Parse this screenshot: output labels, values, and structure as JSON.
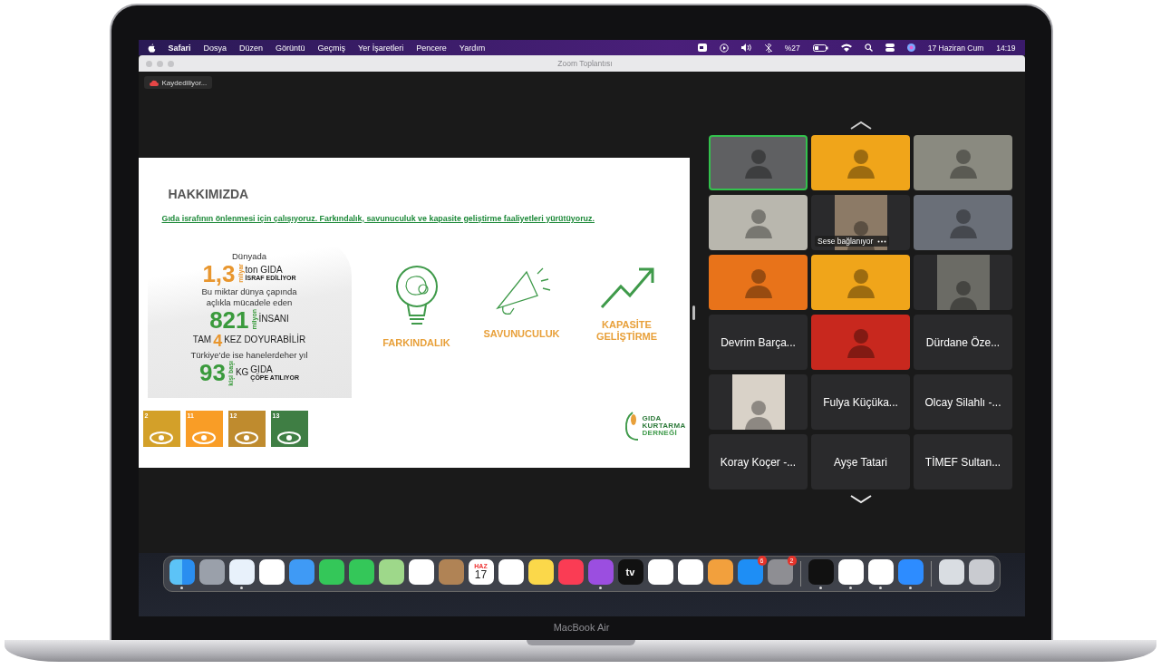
{
  "menubar": {
    "app": "Safari",
    "menus": [
      "Dosya",
      "Düzen",
      "Görüntü",
      "Geçmiş",
      "Yer İşaretleri",
      "Pencere",
      "Yardım"
    ],
    "battery": "%27",
    "date": "17 Haziran Cum",
    "time": "14:19"
  },
  "window": {
    "title": "Zoom Toplantısı",
    "recording": "Kaydediliyor..."
  },
  "slide": {
    "title": "HAKKIMIZDA",
    "subtitle": "Gıda israfının önlenmesi için çalışıyoruz. Farkındalık, savunuculuk ve kapasite geliştirme faaliyetleri yürütüyoruz.",
    "stats": [
      {
        "kind": "line",
        "text": "Dünyada"
      },
      {
        "kind": "figure",
        "number": "1,3",
        "unit": "milyar",
        "text": "ton GIDA",
        "note": "İSRAF EDİLİYOR",
        "color": "#e8962e"
      },
      {
        "kind": "line",
        "text": "Bu miktar dünya çapında"
      },
      {
        "kind": "line",
        "text": "açlıkla mücadele eden"
      },
      {
        "kind": "figure",
        "number": "821",
        "unit": "milyon",
        "text": "İNSANI",
        "color": "#3a9a3c"
      },
      {
        "kind": "times",
        "before": "TAM",
        "number": "4",
        "after": "KEZ DOYURABİLİR"
      },
      {
        "kind": "line",
        "text": "Türkiye'de ise hanelerdeher yıl"
      },
      {
        "kind": "figure",
        "number": "93",
        "unit": "kişi başı",
        "suffix": "KG",
        "text": "GIDA",
        "note": "ÇÖPE ATILIYOR",
        "color": "#3a9a3c"
      }
    ],
    "pillars": [
      {
        "kind": "bulb",
        "label": "FARKINDALIK"
      },
      {
        "kind": "megaphone",
        "label": "SAVUNUCULUK"
      },
      {
        "kind": "growth",
        "label": "KAPASİTE GELİŞTİRME"
      }
    ],
    "goals": [
      {
        "number": "2",
        "color": "#d3a029"
      },
      {
        "number": "11",
        "color": "#f99d26"
      },
      {
        "number": "12",
        "color": "#bf8b2e"
      },
      {
        "number": "13",
        "color": "#3f7e44"
      }
    ],
    "logo": [
      "GIDA",
      "KURTARMA",
      "DERNEĞİ"
    ]
  },
  "participants": [
    {
      "kind": "video",
      "color": "#5f6062",
      "active": true
    },
    {
      "kind": "video",
      "color": "#f0a51a",
      "active": false
    },
    {
      "kind": "video",
      "color": "#8a8a80",
      "active": false
    },
    {
      "kind": "video",
      "color": "#b9b7ae",
      "active": false
    },
    {
      "kind": "portrait",
      "color": "#8c7a66",
      "status": "Sese bağlanıyor",
      "active": false
    },
    {
      "kind": "video",
      "color": "#6a6f78",
      "active": false
    },
    {
      "kind": "video",
      "color": "#e8731a",
      "active": false
    },
    {
      "kind": "video",
      "color": "#f0a51a",
      "active": false
    },
    {
      "kind": "portrait",
      "color": "#6b6b65",
      "active": false
    },
    {
      "kind": "name",
      "name": "Devrim Barça...",
      "active": false
    },
    {
      "kind": "video",
      "color": "#c8281e",
      "active": false
    },
    {
      "kind": "name",
      "name": "Dürdane Öze...",
      "active": false
    },
    {
      "kind": "portrait",
      "color": "#d9d2c8",
      "active": false
    },
    {
      "kind": "name",
      "name": "Fulya Küçüka...",
      "active": false
    },
    {
      "kind": "name",
      "name": "Olcay Silahlı -...",
      "active": false
    },
    {
      "kind": "name",
      "name": "Koray Koçer -...",
      "active": false
    },
    {
      "kind": "name",
      "name": "Ayşe Tatari",
      "active": false
    },
    {
      "kind": "name",
      "name": "TİMEF Sultan...",
      "active": false
    }
  ],
  "dock": [
    {
      "kind": "finder",
      "running": true
    },
    {
      "kind": "launchpad",
      "running": false
    },
    {
      "kind": "safari",
      "running": true
    },
    {
      "kind": "chrome",
      "running": false
    },
    {
      "kind": "mail",
      "running": false
    },
    {
      "kind": "facetime",
      "running": false
    },
    {
      "kind": "messages",
      "running": false
    },
    {
      "kind": "maps",
      "running": false
    },
    {
      "kind": "photos",
      "running": false
    },
    {
      "kind": "contacts",
      "running": false
    },
    {
      "kind": "calendar",
      "month": "HAZ",
      "day": "17",
      "running": false
    },
    {
      "kind": "reminders",
      "running": false
    },
    {
      "kind": "notes",
      "running": false
    },
    {
      "kind": "music",
      "running": false
    },
    {
      "kind": "podcasts",
      "running": true
    },
    {
      "kind": "tv",
      "label": "tv",
      "running": false
    },
    {
      "kind": "numbers",
      "running": false
    },
    {
      "kind": "keynote",
      "running": false
    },
    {
      "kind": "pages",
      "running": false
    },
    {
      "kind": "appstore",
      "badge": "6",
      "running": false
    },
    {
      "kind": "settings",
      "badge": "2",
      "running": false
    },
    {
      "kind": "separator"
    },
    {
      "kind": "spotify",
      "running": true
    },
    {
      "kind": "word",
      "running": true
    },
    {
      "kind": "excel",
      "running": true
    },
    {
      "kind": "zoom",
      "running": true
    },
    {
      "kind": "separator"
    },
    {
      "kind": "preview",
      "running": false
    },
    {
      "kind": "trash",
      "running": false
    }
  ],
  "device": {
    "label": "MacBook Air"
  }
}
